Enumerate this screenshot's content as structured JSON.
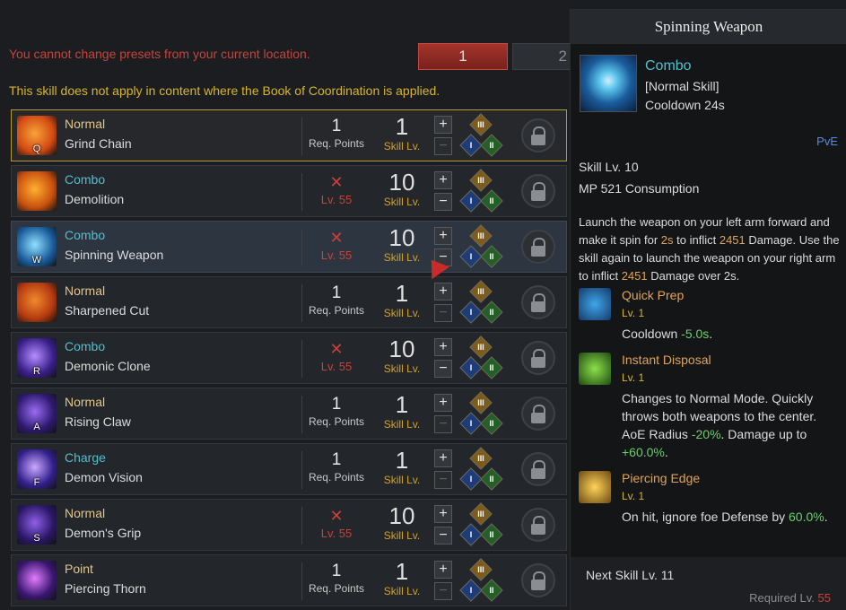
{
  "warning": "You cannot change presets from your current location.",
  "presets": [
    "1",
    "2"
  ],
  "notice": "This skill does not apply in content where the Book of Coordination is applied.",
  "skills": [
    {
      "type": "Normal",
      "name": "Grind Chain",
      "key": "Q",
      "req_num": "1",
      "req_label": "Req. Points",
      "locked": false,
      "skill_lv": "1",
      "skill_lv_label": "Skill Lv.",
      "colors": [
        "#d34a12",
        "#f7a33a"
      ]
    },
    {
      "type": "Combo",
      "name": "Demolition",
      "key": "",
      "req_num": "",
      "req_label": "Lv. 55",
      "locked": true,
      "skill_lv": "10",
      "skill_lv_label": "Skill Lv.",
      "colors": [
        "#c9500f",
        "#ffb02e"
      ]
    },
    {
      "type": "Combo",
      "name": "Spinning Weapon",
      "key": "W",
      "req_num": "",
      "req_label": "Lv. 55",
      "locked": true,
      "skill_lv": "10",
      "skill_lv_label": "Skill Lv.",
      "colors": [
        "#1a5c9c",
        "#8fe0ff"
      ]
    },
    {
      "type": "Normal",
      "name": "Sharpened Cut",
      "key": "",
      "req_num": "1",
      "req_label": "Req. Points",
      "locked": false,
      "skill_lv": "1",
      "skill_lv_label": "Skill Lv.",
      "colors": [
        "#b53a10",
        "#f08a2c"
      ]
    },
    {
      "type": "Combo",
      "name": "Demonic Clone",
      "key": "R",
      "req_num": "",
      "req_label": "Lv. 55",
      "locked": true,
      "skill_lv": "10",
      "skill_lv_label": "Skill Lv.",
      "colors": [
        "#3a1f8a",
        "#b58cff"
      ]
    },
    {
      "type": "Normal",
      "name": "Rising Claw",
      "key": "A",
      "req_num": "1",
      "req_label": "Req. Points",
      "locked": false,
      "skill_lv": "1",
      "skill_lv_label": "Skill Lv.",
      "colors": [
        "#2e1a72",
        "#9b6cf0"
      ]
    },
    {
      "type": "Charge",
      "name": "Demon Vision",
      "key": "F",
      "req_num": "1",
      "req_label": "Req. Points",
      "locked": false,
      "skill_lv": "1",
      "skill_lv_label": "Skill Lv.",
      "colors": [
        "#33208c",
        "#c9a8ff"
      ]
    },
    {
      "type": "Normal",
      "name": "Demon's Grip",
      "key": "S",
      "req_num": "",
      "req_label": "Lv. 55",
      "locked": true,
      "skill_lv": "10",
      "skill_lv_label": "Skill Lv.",
      "colors": [
        "#2b1766",
        "#8e5fe8"
      ]
    },
    {
      "type": "Point",
      "name": "Piercing Thorn",
      "key": "",
      "req_num": "1",
      "req_label": "Req. Points",
      "locked": false,
      "skill_lv": "1",
      "skill_lv_label": "Skill Lv.",
      "colors": [
        "#3a1670",
        "#e07cff"
      ]
    }
  ],
  "tooltip": {
    "title": "Spinning Weapon",
    "type": "Combo",
    "kind": "[Normal Skill]",
    "cooldown": "Cooldown 24s",
    "mode": "PvE",
    "skill_lv": "Skill Lv. 10",
    "mp": "MP 521 Consumption",
    "desc_1": "Launch the weapon on your left arm forward and make it spin for",
    "desc_2": "2s",
    "desc_3": "to inflict",
    "desc_4": "2451",
    "desc_5": "Damage. Use the skill again to launch the weapon on your right arm to inflict",
    "desc_6": "2451",
    "desc_7": "Damage over 2s.",
    "tripods": [
      {
        "name": "Quick Prep",
        "lv": "Lv. 1",
        "text_a": "Cooldown ",
        "text_b": "-5.0s",
        "text_c": "."
      },
      {
        "name": "Instant Disposal",
        "lv": "Lv. 1",
        "text_a": "Changes to Normal Mode. Quickly throws both weapons to the center. AoE Radius ",
        "text_b": "-20%",
        "text_c": ". Damage up to ",
        "text_d": "+60.0%",
        "text_e": "."
      },
      {
        "name": "Piercing Edge",
        "lv": "Lv. 1",
        "text_a": "On hit, ignore foe Defense by ",
        "text_b": "60.0%",
        "text_c": "."
      }
    ],
    "next": "Next Skill Lv. 11",
    "req_label": "Required Lv.",
    "req_value": "55"
  },
  "gem_labels": [
    "III",
    "I",
    "II"
  ],
  "colors": {
    "combo": "#52bfcf",
    "normal": "#e2c58c",
    "locked": "#c9413a",
    "skill_lv": "#d1a12a",
    "accent": "#b79a3a"
  }
}
